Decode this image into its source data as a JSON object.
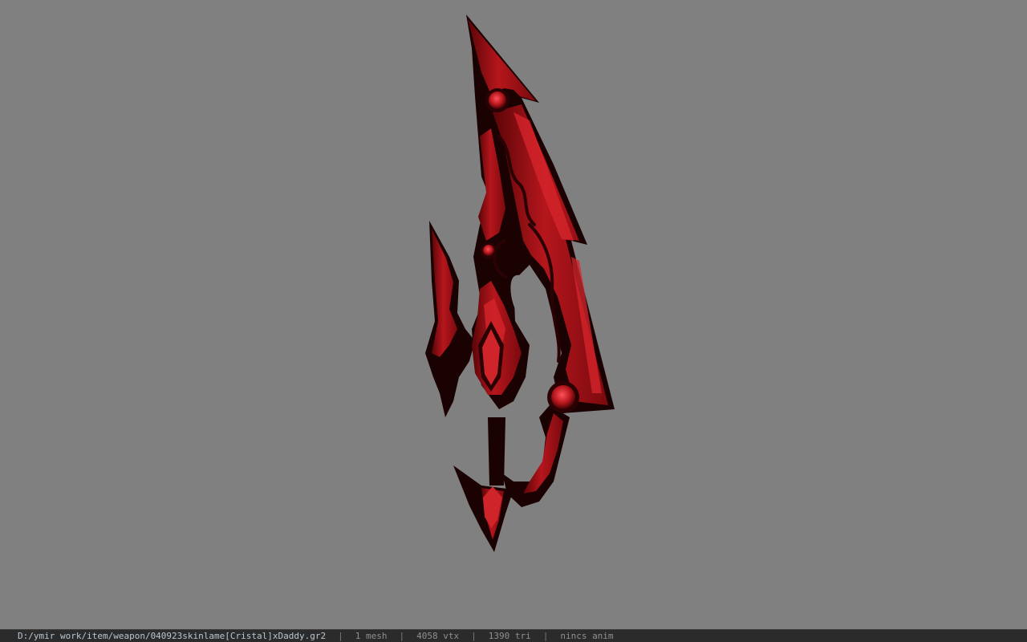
{
  "viewport": {
    "background": "#808080",
    "model_name": "3D weapon model preview (crimson blade)"
  },
  "statusbar": {
    "file_path": "D:/ymir work/item/weapon/040923skinlame[Cristal]xDaddy.gr2",
    "separator": "|",
    "mesh_count": "1 mesh",
    "vertex_count": "4058 vtx",
    "triangle_count": "1390 tri",
    "anim_status": "nincs anim"
  },
  "colors": {
    "blade_red": "#b5161c",
    "blade_dark": "#2a0204",
    "blade_highlight": "#d8262c",
    "statusbar_bg": "#2b2b2b"
  }
}
